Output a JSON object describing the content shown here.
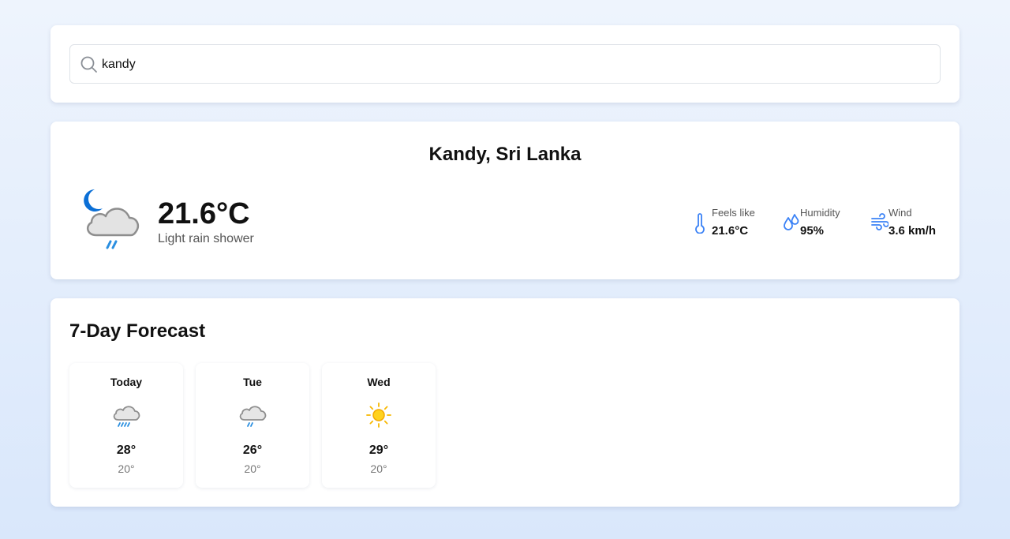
{
  "search": {
    "value": "kandy",
    "icon": "search-icon"
  },
  "current": {
    "location": "Kandy, Sri Lanka",
    "temperature": "21.6°C",
    "condition": "Light rain shower",
    "icon": "night-rain-shower-icon",
    "stats": {
      "feels_like": {
        "label": "Feels like",
        "value": "21.6°C",
        "icon": "thermometer-icon"
      },
      "humidity": {
        "label": "Humidity",
        "value": "95%",
        "icon": "droplets-icon"
      },
      "wind": {
        "label": "Wind",
        "value": "3.6 km/h",
        "icon": "wind-icon"
      }
    }
  },
  "forecast": {
    "title": "7-Day Forecast",
    "days": [
      {
        "day": "Today",
        "high": "28°",
        "low": "20°",
        "icon": "rain-cloud-icon"
      },
      {
        "day": "Tue",
        "high": "26°",
        "low": "20°",
        "icon": "light-rain-cloud-icon"
      },
      {
        "day": "Wed",
        "high": "29°",
        "low": "20°",
        "icon": "sun-icon"
      }
    ]
  },
  "colors": {
    "accent": "#3b82f6",
    "rain": "#2a8fe0",
    "moon": "#0b6fd6",
    "sun": "#f7b800"
  }
}
